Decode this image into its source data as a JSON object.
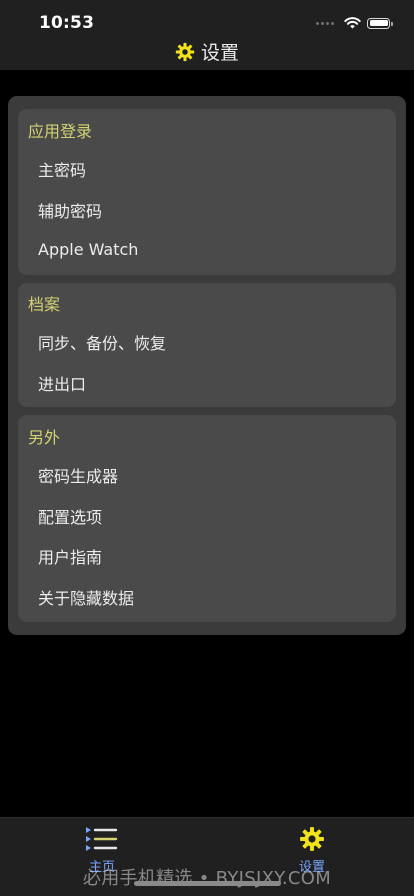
{
  "status_bar": {
    "time": "10:53"
  },
  "header": {
    "title": "设置",
    "icon": "gear-icon",
    "icon_color": "#f2e21a"
  },
  "sections": [
    {
      "title": "应用登录",
      "items": [
        "主密码",
        "辅助密码",
        "Apple Watch"
      ]
    },
    {
      "title": "档案",
      "items": [
        "同步、备份、恢复",
        "进出口"
      ]
    },
    {
      "title": "另外",
      "items": [
        "密码生成器",
        "配置选项",
        "用户指南",
        "关于隐藏数据"
      ]
    }
  ],
  "tab_bar": {
    "tabs": [
      {
        "label": "主页",
        "icon": "list-icon"
      },
      {
        "label": "设置",
        "icon": "gear-icon"
      }
    ]
  },
  "watermark": "必用手机精选 • BYJSJXY.COM",
  "colors": {
    "section_header": "#d4d271",
    "tab_label": "#7aa6ff",
    "accent_yellow": "#f2e21a"
  }
}
